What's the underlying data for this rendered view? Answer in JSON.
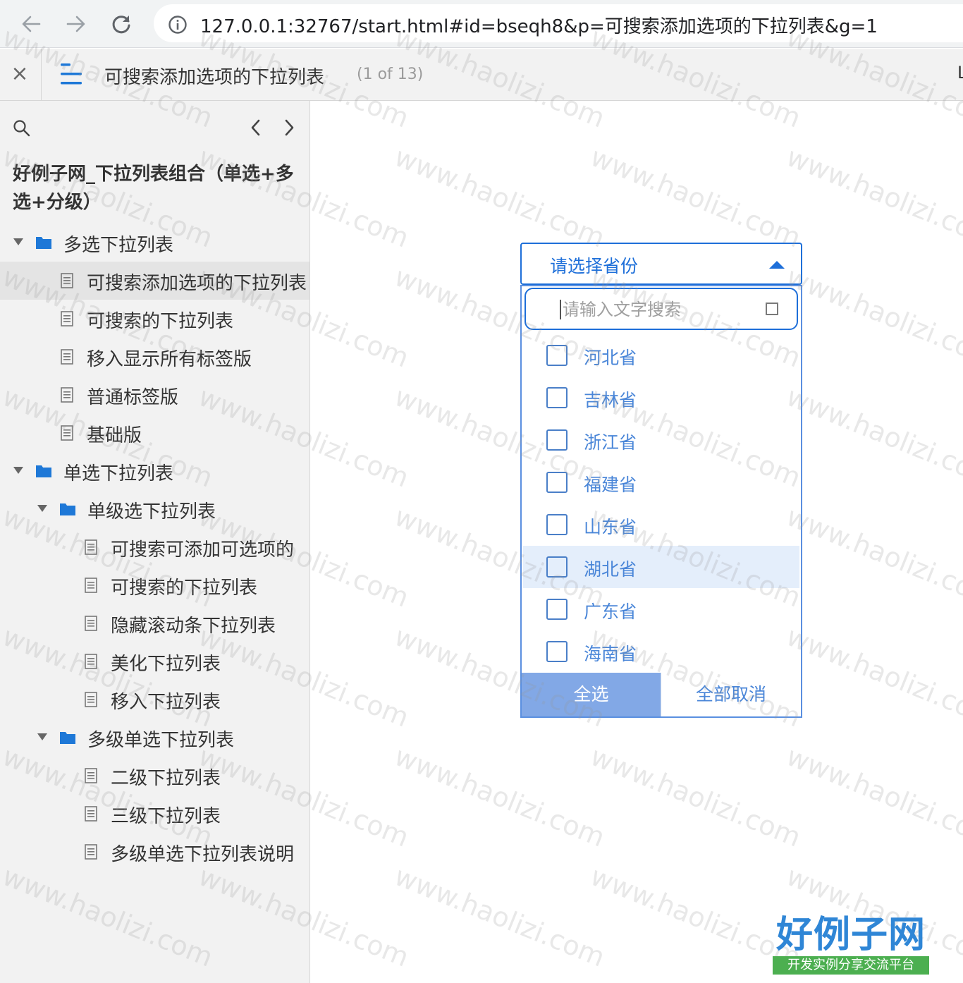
{
  "browser": {
    "url": "127.0.0.1:32767/start.html#id=bseqh8&p=可搜索添加选项的下拉列表&g=1",
    "back_icon": "arrow-left-icon",
    "forward_icon": "arrow-right-icon",
    "reload_icon": "reload-icon",
    "info_icon": "info-icon"
  },
  "toolbar": {
    "close_label": "×",
    "menu_icon": "hamburger-menu-icon",
    "page_title": "可搜索添加选项的下拉列表",
    "page_count": "(1 of 13)",
    "edge_glyph": "L"
  },
  "sidebar": {
    "project_title": "好例子网_下拉列表组合（单选+多选+分级）",
    "tree": [
      {
        "type": "folder",
        "label": "多选下拉列表",
        "level": 0
      },
      {
        "type": "page",
        "label": "可搜索添加选项的下拉列表",
        "level": 1,
        "selected": true
      },
      {
        "type": "page",
        "label": "可搜索的下拉列表",
        "level": 1
      },
      {
        "type": "page",
        "label": "移入显示所有标签版",
        "level": 1
      },
      {
        "type": "page",
        "label": "普通标签版",
        "level": 1
      },
      {
        "type": "page",
        "label": "基础版",
        "level": 1
      },
      {
        "type": "folder",
        "label": "单选下拉列表",
        "level": 0
      },
      {
        "type": "folder",
        "label": "单级选下拉列表",
        "level": 1
      },
      {
        "type": "page",
        "label": "可搜索可添加可选项的",
        "level": 2
      },
      {
        "type": "page",
        "label": "可搜索的下拉列表",
        "level": 2
      },
      {
        "type": "page",
        "label": "隐藏滚动条下拉列表",
        "level": 2
      },
      {
        "type": "page",
        "label": "美化下拉列表",
        "level": 2
      },
      {
        "type": "page",
        "label": "移入下拉列表",
        "level": 2
      },
      {
        "type": "folder",
        "label": "多级单选下拉列表",
        "level": 1
      },
      {
        "type": "page",
        "label": "二级下拉列表",
        "level": 2
      },
      {
        "type": "page",
        "label": "三级下拉列表",
        "level": 2
      },
      {
        "type": "page",
        "label": "多级单选下拉列表说明",
        "level": 2
      }
    ]
  },
  "dropdown": {
    "header": "请选择省份",
    "search_placeholder": "请输入文字搜索",
    "options": [
      {
        "label": "河北省",
        "checked": false
      },
      {
        "label": "吉林省",
        "checked": false
      },
      {
        "label": "浙江省",
        "checked": false
      },
      {
        "label": "福建省",
        "checked": false
      },
      {
        "label": "山东省",
        "checked": false
      },
      {
        "label": "湖北省",
        "checked": false,
        "hover": true
      },
      {
        "label": "广东省",
        "checked": false
      },
      {
        "label": "海南省",
        "checked": false
      }
    ],
    "select_all": "全选",
    "deselect_all": "全部取消"
  },
  "watermark": {
    "text": "www.haolizi.com",
    "logo_main": "好例子网",
    "logo_sub": "开发实例分享交流平台"
  },
  "colors": {
    "accent": "#1e6fd9",
    "option_text": "#4a86d8",
    "select_all_bg": "#82a8e6",
    "hover_bg": "#e4eefb",
    "sidebar_bg": "#f2f2f2",
    "folder": "#1e78d7"
  }
}
